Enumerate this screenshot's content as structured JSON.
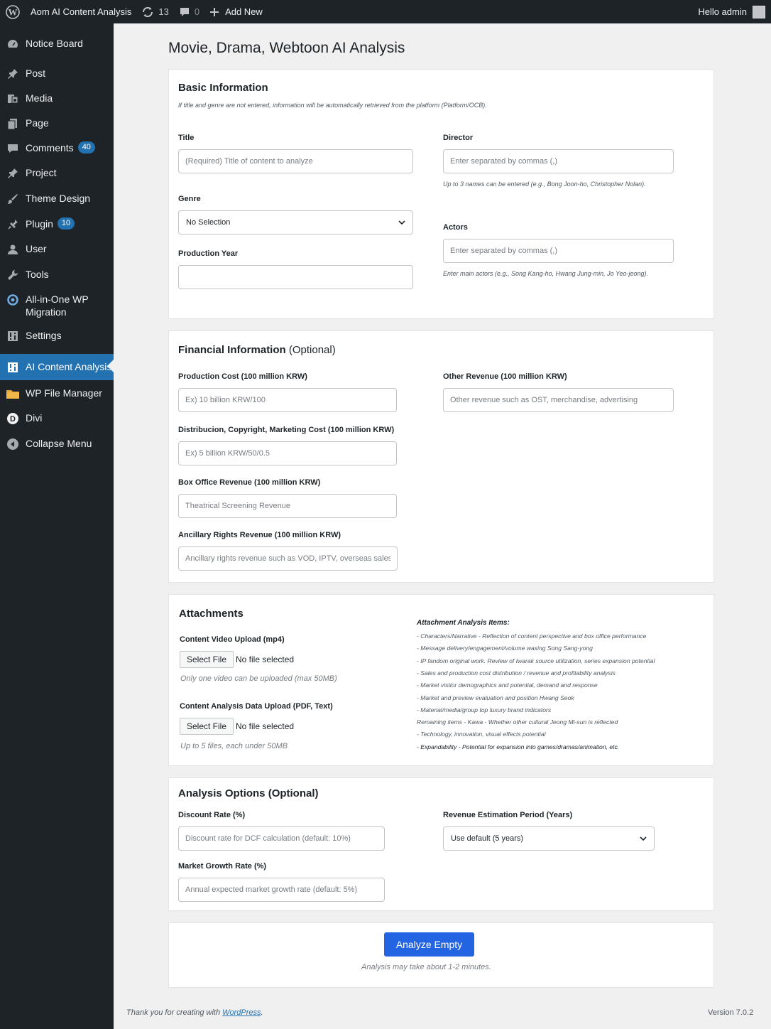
{
  "admin_bar": {
    "site_name": "A",
    "app_title": "om AI Content Analysis",
    "updates_count": "13",
    "comments_count": "0",
    "add_new": "Add New",
    "greeting": "Hello admin"
  },
  "sidebar": {
    "items": [
      {
        "label": "Notice Board",
        "icon": "dashboard-icon"
      },
      {
        "label": "Post",
        "icon": "pin-icon"
      },
      {
        "label": "Media",
        "icon": "media-icon"
      },
      {
        "label": "Page",
        "icon": "page-icon"
      },
      {
        "label": "Comments",
        "icon": "comment-icon",
        "badge": "40"
      },
      {
        "label": "Project",
        "icon": "pin-icon"
      },
      {
        "label": "Theme Design",
        "icon": "brush-icon"
      },
      {
        "label": "Plugin",
        "icon": "plugin-icon",
        "badge": "10"
      },
      {
        "label": "User",
        "icon": "user-icon"
      },
      {
        "label": "Tools",
        "icon": "wrench-icon"
      },
      {
        "label": "All-in-One WP Migration",
        "icon": "migration-icon"
      },
      {
        "label": "Settings",
        "icon": "settings-icon"
      },
      {
        "label": "AI Content Analysis",
        "icon": "grid-icon",
        "active": true
      },
      {
        "label": "WP File Manager",
        "icon": "folder-icon"
      },
      {
        "label": "Divi",
        "icon": "divi-icon"
      },
      {
        "label": "Collapse Menu",
        "icon": "collapse-icon"
      }
    ],
    "active_color": "#2271b1"
  },
  "page": {
    "title": "Movie, Drama, Webtoon AI Analysis"
  },
  "basic": {
    "title": "Basic Information",
    "hint": "If title and genre are not entered, information will be automatically retrieved from the platform (Platform/OCB).",
    "title_label": "Title",
    "title_placeholder": "(Required) Title of content to analyze",
    "director_label": "Director",
    "director_placeholder": "Enter separated by commas (,)",
    "director_help": "Up to 3 names can be entered (e.g., Bong Joon-ho, Christopher Nolan).",
    "genre_label": "Genre",
    "genre_value": "No Selection",
    "actors_label": "Actors",
    "actors_placeholder": "Enter separated by commas (,)",
    "actors_help": "Enter main actors (e.g., Song Kang-ho, Hwang Jung-min, Jo Yeo-jeong).",
    "year_label": "Production Year",
    "year_value": ""
  },
  "financial": {
    "title": "Financial Information",
    "optional": "(Optional)",
    "production_cost_label": "Production Cost (100 million KRW)",
    "production_cost_placeholder": "Ex) 10 billion KRW/100",
    "other_revenue_label": "Other Revenue (100 million KRW)",
    "other_revenue_placeholder": "Other revenue such as OST, merchandise, advertising",
    "distribution_label": "Distribucion, Copyright, Marketing Cost (100 million KRW)",
    "distribution_placeholder": "Ex) 5 billion KRW/50/0.5",
    "box_office_label": "Box Office Revenue (100 million KRW)",
    "box_office_placeholder": "Theatrical Screening Revenue",
    "ancillary_label": "Ancillary Rights Revenue (100 million KRW)",
    "ancillary_placeholder": "Ancillary rights revenue such as VOD, IPTV, overseas sales"
  },
  "attachments": {
    "title": "Attachments",
    "video_label": "Content Video Upload (mp4)",
    "select_file": "Select File",
    "no_file": "No file selected",
    "video_hint": "Only one video can be uploaded (max 50MB)",
    "data_label": "Content Analysis Data Upload (PDF, Text)",
    "data_hint": "Up to 5 files, each under 50MB",
    "items_title": "Attachment Analysis Items:",
    "items": [
      "- Characters/Narrative - Reflection of content perspective and box office performance",
      "- Message delivery/engagement/volume waxing Song Sang-yong",
      "- IP fandom original work. Review of Iwarak source utilization, series expansion potential",
      "- Sales and production cost distribution / revenue and profitability analysis",
      "- Market vistior demographics and potential, demand and response",
      "- Market and preview evaluation and position Hwang Seok",
      "- Material/media/group top luxury brand indicators",
      "Remaining items - Kawa - Whether other cultural Jeong Mi-sun is reflected",
      "- Technology, innovation, visual effects potential",
      "- Expandability - Potential for expansion into games/dramas/animation, etc."
    ]
  },
  "options": {
    "title": "Analysis Options (Optional)",
    "discount_label": "Discount Rate (%)",
    "discount_placeholder": "Discount rate for DCF calculation (default: 10%)",
    "period_label": "Revenue Estimation Period (Years)",
    "period_value": "Use default (5 years)",
    "growth_label": "Market Growth Rate (%)",
    "growth_placeholder": "Annual expected market growth rate (default: 5%)"
  },
  "submit": {
    "button": "Analyze Empty",
    "note": "Analysis may take about 1-2 minutes.",
    "button_color": "#2364e3"
  },
  "footer": {
    "thanks_prefix": "Thank you for creating with ",
    "wordpress_link": "WordPress",
    "thanks_suffix": ".",
    "version": "Version 7.0.2"
  }
}
